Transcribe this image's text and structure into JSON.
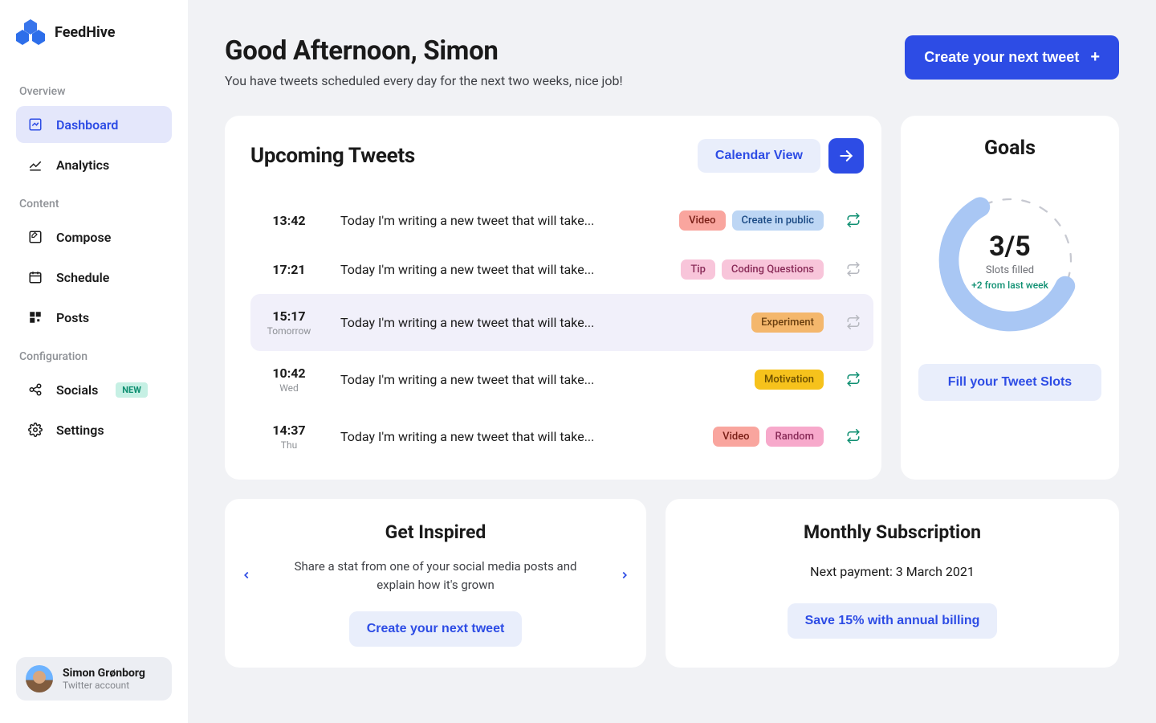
{
  "brand": {
    "name": "FeedHive"
  },
  "sidebar": {
    "sections": {
      "overview": "Overview",
      "content": "Content",
      "configuration": "Configuration"
    },
    "items": {
      "dashboard": "Dashboard",
      "analytics": "Analytics",
      "compose": "Compose",
      "schedule": "Schedule",
      "posts": "Posts",
      "socials": "Socials",
      "settings": "Settings"
    },
    "newBadge": "NEW"
  },
  "user": {
    "name": "Simon Grønborg",
    "sub": "Twitter account"
  },
  "header": {
    "greeting": "Good Afternoon, Simon",
    "sub": "You have tweets scheduled every day for the next two weeks, nice job!",
    "cta": "Create your next tweet"
  },
  "upcoming": {
    "title": "Upcoming Tweets",
    "calendar_btn": "Calendar View",
    "rows": [
      {
        "time": "13:42",
        "sub": "",
        "text": "Today I'm writing a new tweet that will take...",
        "tags": [
          {
            "label": "Video",
            "cls": "tag-red"
          },
          {
            "label": "Create in public",
            "cls": "tag-blue"
          }
        ],
        "rt": true
      },
      {
        "time": "17:21",
        "sub": "",
        "text": "Today I'm writing a new tweet that will take...",
        "tags": [
          {
            "label": "Tip",
            "cls": "tag-pink"
          },
          {
            "label": "Coding Questions",
            "cls": "tag-pink"
          }
        ],
        "rt": false
      },
      {
        "time": "15:17",
        "sub": "Tomorrow",
        "text": "Today I'm writing a new tweet that will take...",
        "tags": [
          {
            "label": "Experiment",
            "cls": "tag-orange"
          }
        ],
        "rt": false,
        "highlight": true
      },
      {
        "time": "10:42",
        "sub": "Wed",
        "text": "Today I'm writing a new tweet that will take...",
        "tags": [
          {
            "label": "Motivation",
            "cls": "tag-yellow"
          }
        ],
        "rt": true
      },
      {
        "time": "14:37",
        "sub": "Thu",
        "text": "Today I'm writing a new tweet that will take...",
        "tags": [
          {
            "label": "Video",
            "cls": "tag-red"
          },
          {
            "label": "Random",
            "cls": "tag-pink2"
          }
        ],
        "rt": true
      }
    ]
  },
  "goals": {
    "title": "Goals",
    "main": "3/5",
    "sub": "Slots filled",
    "delta": "+2 from last week",
    "button": "Fill your Tweet Slots"
  },
  "inspire": {
    "title": "Get Inspired",
    "text": "Share a stat from one of your social media posts and explain how it's grown",
    "button": "Create your next tweet"
  },
  "subscription": {
    "title": "Monthly Subscription",
    "text": "Next payment: 3 March 2021",
    "button": "Save 15% with annual billing"
  }
}
